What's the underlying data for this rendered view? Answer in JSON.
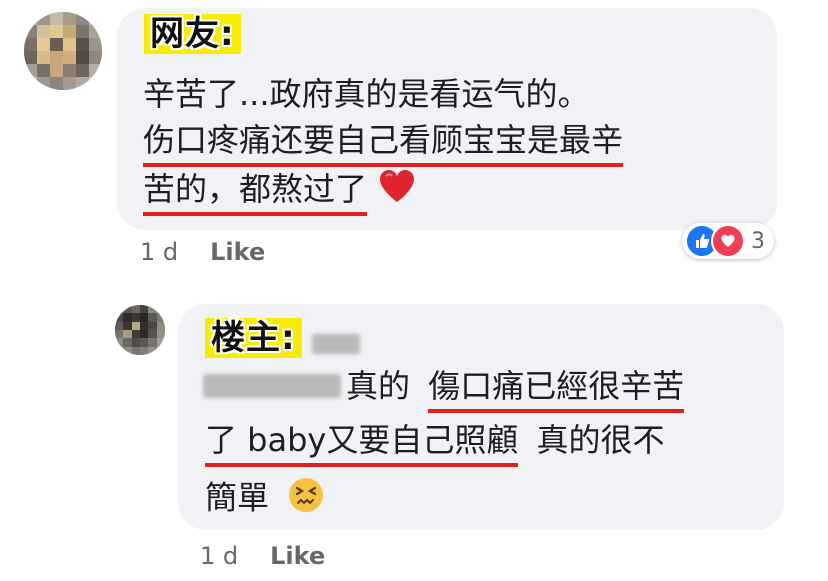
{
  "comment1": {
    "author_label": "网友:",
    "lines": [
      "辛苦了...政府真的是看运气的。",
      "伤口疼痛还要自己看顾宝宝是最辛",
      "苦的，都熬过了"
    ],
    "emoji": "heart-emoji",
    "time": "1 d",
    "like_label": "Like",
    "reaction_count": "3",
    "reaction_icons": [
      "like-icon",
      "love-icon"
    ]
  },
  "comment2": {
    "author_label": "楼主:",
    "line1_text": "真的",
    "line1_underlined": "傷口痛已經很辛苦",
    "line2_underlined": "了 baby又要自己照顧",
    "line2_text": "真的很不",
    "line3_text": "簡單",
    "emoji": "confounded-face-emoji",
    "time": "1 d",
    "like_label": "Like"
  },
  "colors": {
    "bubble_bg": "#f0f2f5",
    "label_bg": "#f7ec00",
    "underline": "#e0201d",
    "like_blue": "#1877f2",
    "love_red": "#f33e58",
    "meta_gray": "#65676b"
  }
}
